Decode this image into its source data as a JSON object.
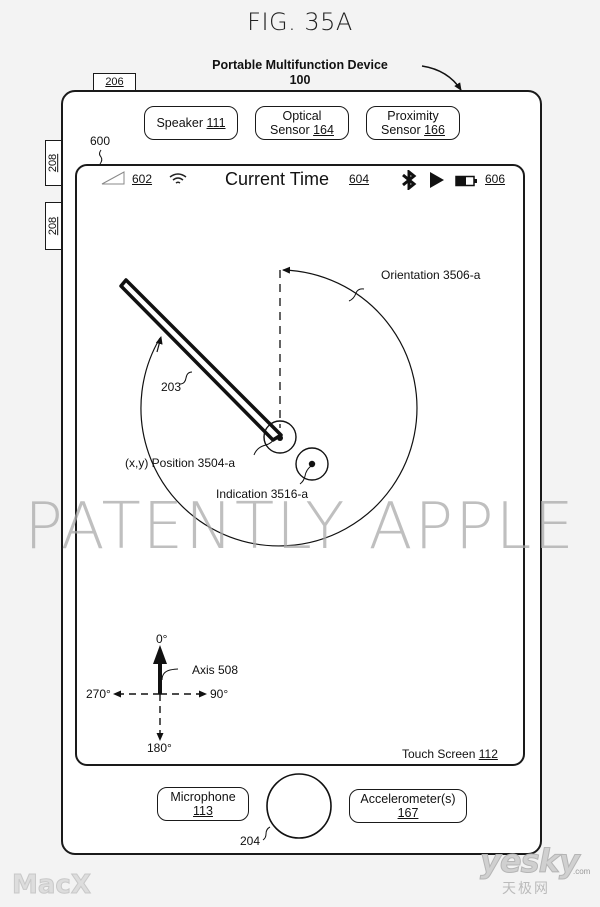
{
  "figure": {
    "title": "FIG. 35A",
    "device_label": "Portable Multifunction Device",
    "device_ref": "100"
  },
  "hardware": {
    "side_button_top": "206",
    "side_buttons_left": [
      "208",
      "208"
    ],
    "speaker": {
      "label": "Speaker",
      "ref": "111"
    },
    "optical_sensor": {
      "line1": "Optical",
      "line2": "Sensor",
      "ref": "164"
    },
    "proximity_sensor": {
      "line1": "Proximity",
      "line2": "Sensor",
      "ref": "166"
    },
    "microphone": {
      "label": "Microphone",
      "ref": "113"
    },
    "accelerometer": {
      "label": "Accelerometer(s)",
      "ref": "167"
    },
    "home_button_ref": "204"
  },
  "screen": {
    "ref": "600",
    "touch_screen_label": "Touch Screen",
    "touch_screen_ref": "112",
    "status_bar": {
      "signal_ref": "602",
      "time_label": "Current Time",
      "time_ref": "604",
      "battery_ref": "606",
      "icons": [
        "signal-icon",
        "wifi-icon",
        "bluetooth-icon",
        "play-icon",
        "battery-icon"
      ]
    }
  },
  "diagram": {
    "stylus_ref": "203",
    "orientation_label": "Orientation 3506-a",
    "position_label": "(x,y) Position 3504-a",
    "indication_label": "Indication 3516-a",
    "axis": {
      "label": "Axis 508",
      "top": "0°",
      "right": "90°",
      "bottom": "180°",
      "left": "270°"
    }
  },
  "watermarks": {
    "main": "PATENTLY APPLE",
    "macx": "MacX",
    "yesky": "yesky",
    "yesky_sub": "天极网",
    "yesky_com": ".com"
  }
}
